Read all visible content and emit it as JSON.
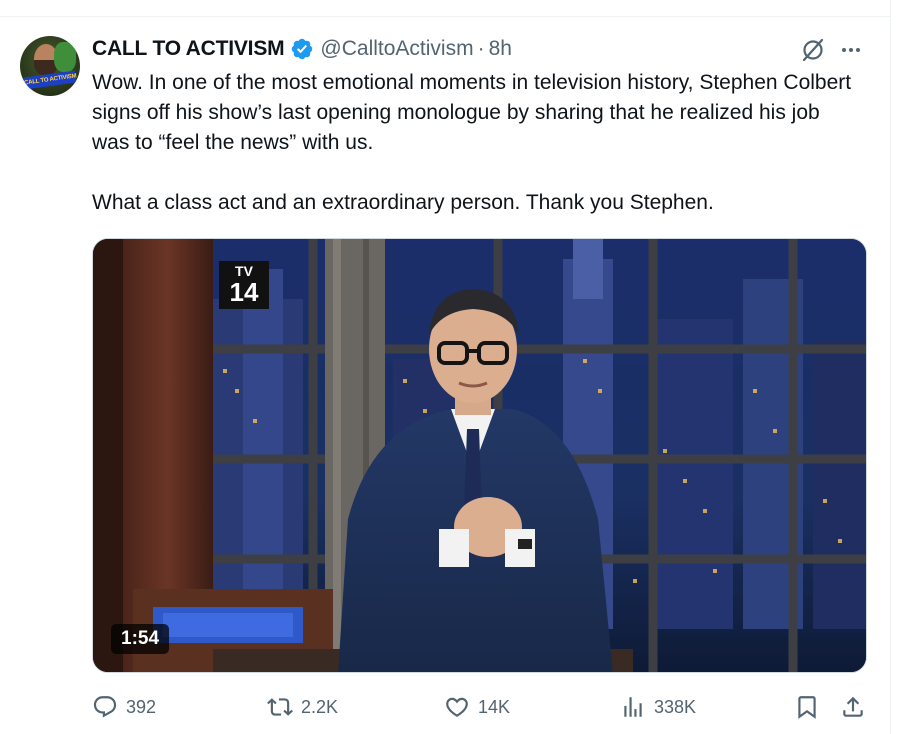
{
  "tweet": {
    "author": {
      "name": "CALL TO ACTIVISM",
      "handle": "@CalltoActivism",
      "separator": "·",
      "time": "8h",
      "avatar_text": "CALL TO ACTIVISM",
      "verified_icon": "verified-badge-icon"
    },
    "text_paragraph_1": "Wow. In one of the most emotional moments in television history, Stephen Colbert signs off his show’s last opening monologue by sharing that he realized his job was to “feel the news” with us.",
    "text_paragraph_2": "What a class act and an extraordinary person. Thank you Stephen.",
    "media": {
      "type": "video",
      "duration": "1:54",
      "rating_top": "TV",
      "rating_age": "14"
    },
    "actions": {
      "replies": "392",
      "reposts": "2.2K",
      "likes": "14K",
      "views": "338K"
    }
  },
  "colors": {
    "text_primary": "#0f1419",
    "text_secondary": "#536471",
    "verified": "#1d9bf0",
    "border": "#cfd9de"
  },
  "icons": {
    "grok": "grok-icon",
    "more": "more-options-icon",
    "reply": "reply-icon",
    "retweet": "retweet-icon",
    "like": "heart-icon",
    "views": "analytics-icon",
    "bookmark": "bookmark-icon",
    "share": "share-icon"
  }
}
